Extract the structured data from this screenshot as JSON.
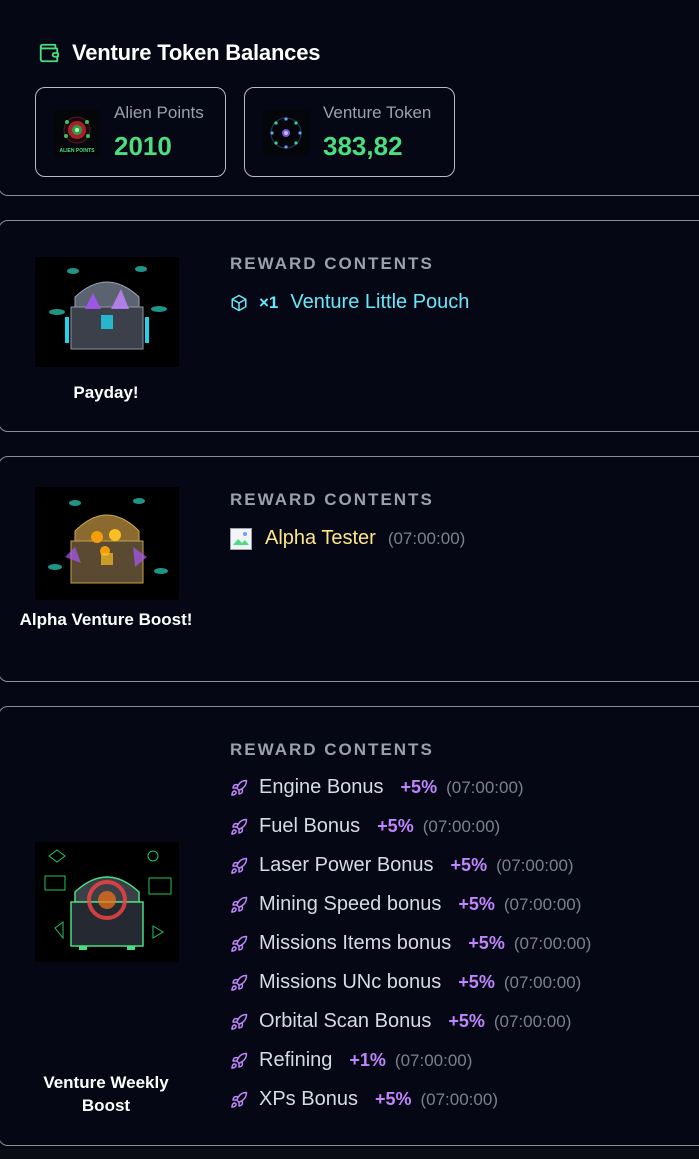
{
  "balances": {
    "title": "Venture Token Balances",
    "icon": "wallet-icon",
    "cards": [
      {
        "label": "Alien Points",
        "value": "2010",
        "thumb_text": "ALIEN POINTS"
      },
      {
        "label": "Venture Token",
        "value": "383,82"
      }
    ]
  },
  "rewards": [
    {
      "name": "Payday!",
      "contents_title": "REWARD CONTENTS",
      "items": [
        {
          "icon": "cube-icon",
          "qty": "×1",
          "name": "Venture Little Pouch"
        }
      ]
    },
    {
      "name": "Alpha Venture Boost!",
      "contents_title": "REWARD CONTENTS",
      "items": [
        {
          "icon": "broken-image-icon",
          "name": "Alpha Tester",
          "duration": "(07:00:00)"
        }
      ]
    },
    {
      "name": "Venture Weekly Boost",
      "contents_title": "REWARD CONTENTS",
      "items": [
        {
          "icon": "rocket-icon",
          "name": "Engine Bonus",
          "pct": "+5%",
          "duration": "(07:00:00)"
        },
        {
          "icon": "rocket-icon",
          "name": "Fuel Bonus",
          "pct": "+5%",
          "duration": "(07:00:00)"
        },
        {
          "icon": "rocket-icon",
          "name": "Laser Power Bonus",
          "pct": "+5%",
          "duration": "(07:00:00)"
        },
        {
          "icon": "rocket-icon",
          "name": "Mining Speed bonus",
          "pct": "+5%",
          "duration": "(07:00:00)"
        },
        {
          "icon": "rocket-icon",
          "name": "Missions Items bonus",
          "pct": "+5%",
          "duration": "(07:00:00)"
        },
        {
          "icon": "rocket-icon",
          "name": "Missions UNc bonus",
          "pct": "+5%",
          "duration": "(07:00:00)"
        },
        {
          "icon": "rocket-icon",
          "name": "Orbital Scan Bonus",
          "pct": "+5%",
          "duration": "(07:00:00)"
        },
        {
          "icon": "rocket-icon",
          "name": "Refining",
          "pct": "+1%",
          "duration": "(07:00:00)"
        },
        {
          "icon": "rocket-icon",
          "name": "XPs Bonus",
          "pct": "+5%",
          "duration": "(07:00:00)"
        }
      ]
    }
  ],
  "colors": {
    "background": "#050814",
    "accent_green": "#4ade80",
    "accent_cyan": "#67e8f9",
    "accent_yellow": "#fde68a",
    "accent_purple": "#c084fc",
    "muted": "#9aa0ad"
  }
}
